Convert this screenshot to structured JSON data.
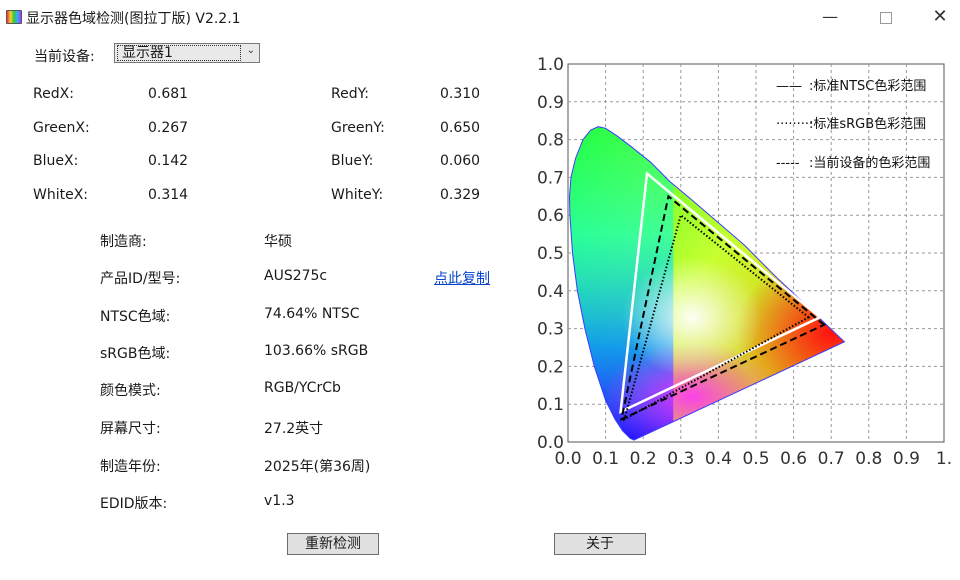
{
  "window": {
    "title": "显示器色域检测(图拉丁版) V2.2.1",
    "minimize_glyph": "—",
    "close_glyph": "✕"
  },
  "device": {
    "label": "当前设备:",
    "selected": "显示器1"
  },
  "coords": {
    "red_x_label": "RedX:",
    "red_x": "0.681",
    "red_y_label": "RedY:",
    "red_y": "0.310",
    "green_x_label": "GreenX:",
    "green_x": "0.267",
    "green_y_label": "GreenY:",
    "green_y": "0.650",
    "blue_x_label": "BlueX:",
    "blue_x": "0.142",
    "blue_y_label": "BlueY:",
    "blue_y": "0.060",
    "white_x_label": "WhiteX:",
    "white_x": "0.314",
    "white_y_label": "WhiteY:",
    "white_y": "0.329"
  },
  "info": [
    {
      "label": "制造商:",
      "value": "华硕"
    },
    {
      "label": "产品ID/型号:",
      "value": "AUS275c"
    },
    {
      "label": "NTSC色域:",
      "value": "74.64% NTSC"
    },
    {
      "label": "sRGB色域:",
      "value": "103.66% sRGB"
    },
    {
      "label": "颜色模式:",
      "value": "RGB/YCrCb"
    },
    {
      "label": "屏幕尺寸:",
      "value": "27.2英寸"
    },
    {
      "label": "制造年份:",
      "value": "2025年(第36周)"
    },
    {
      "label": "EDID版本:",
      "value": "v1.3"
    }
  ],
  "copy_link": "点此复制",
  "buttons": {
    "redetect": "重新检测",
    "about": "关于"
  },
  "chart_data": {
    "type": "line",
    "title": "",
    "xlabel": "",
    "ylabel": "",
    "xlim": [
      0,
      1.0
    ],
    "ylim": [
      0,
      1.0
    ],
    "x_ticks": [
      "0.0",
      "0.1",
      "0.2",
      "0.3",
      "0.4",
      "0.5",
      "0.6",
      "0.7",
      "0.8",
      "0.9",
      "1."
    ],
    "y_ticks": [
      "0.0",
      "0.1",
      "0.2",
      "0.3",
      "0.4",
      "0.5",
      "0.6",
      "0.7",
      "0.8",
      "0.9",
      "1.0"
    ],
    "grid": true,
    "legend_position": "top-right",
    "legend": [
      {
        "sample": "——",
        "label": ":标准NTSC色彩范围"
      },
      {
        "sample": "·········",
        "label": ":标准sRGB色彩范围"
      },
      {
        "sample": "-----",
        "label": ":当前设备的色彩范围"
      }
    ],
    "series": [
      {
        "name": "标准NTSC色彩范围",
        "color": "#ffffff",
        "dash": "solid",
        "points": [
          [
            0.67,
            0.33
          ],
          [
            0.21,
            0.71
          ],
          [
            0.14,
            0.08
          ]
        ]
      },
      {
        "name": "标准sRGB色彩范围",
        "color": "#000000",
        "dash": "dotted",
        "points": [
          [
            0.64,
            0.33
          ],
          [
            0.3,
            0.6
          ],
          [
            0.15,
            0.06
          ]
        ]
      },
      {
        "name": "当前设备的色彩范围",
        "color": "#000000",
        "dash": "dashed",
        "points": [
          [
            0.681,
            0.31
          ],
          [
            0.267,
            0.65
          ],
          [
            0.142,
            0.06
          ]
        ]
      }
    ],
    "locus": [
      [
        0.175,
        0.005
      ],
      [
        0.165,
        0.01
      ],
      [
        0.145,
        0.03
      ],
      [
        0.125,
        0.06
      ],
      [
        0.1,
        0.11
      ],
      [
        0.07,
        0.2
      ],
      [
        0.045,
        0.3
      ],
      [
        0.025,
        0.4
      ],
      [
        0.012,
        0.5
      ],
      [
        0.005,
        0.6
      ],
      [
        0.004,
        0.65
      ],
      [
        0.008,
        0.7
      ],
      [
        0.02,
        0.75
      ],
      [
        0.04,
        0.8
      ],
      [
        0.06,
        0.825
      ],
      [
        0.08,
        0.834
      ],
      [
        0.1,
        0.83
      ],
      [
        0.13,
        0.81
      ],
      [
        0.17,
        0.78
      ],
      [
        0.22,
        0.74
      ],
      [
        0.27,
        0.69
      ],
      [
        0.33,
        0.64
      ],
      [
        0.4,
        0.58
      ],
      [
        0.47,
        0.52
      ],
      [
        0.55,
        0.44
      ],
      [
        0.64,
        0.355
      ],
      [
        0.735,
        0.265
      ]
    ]
  }
}
